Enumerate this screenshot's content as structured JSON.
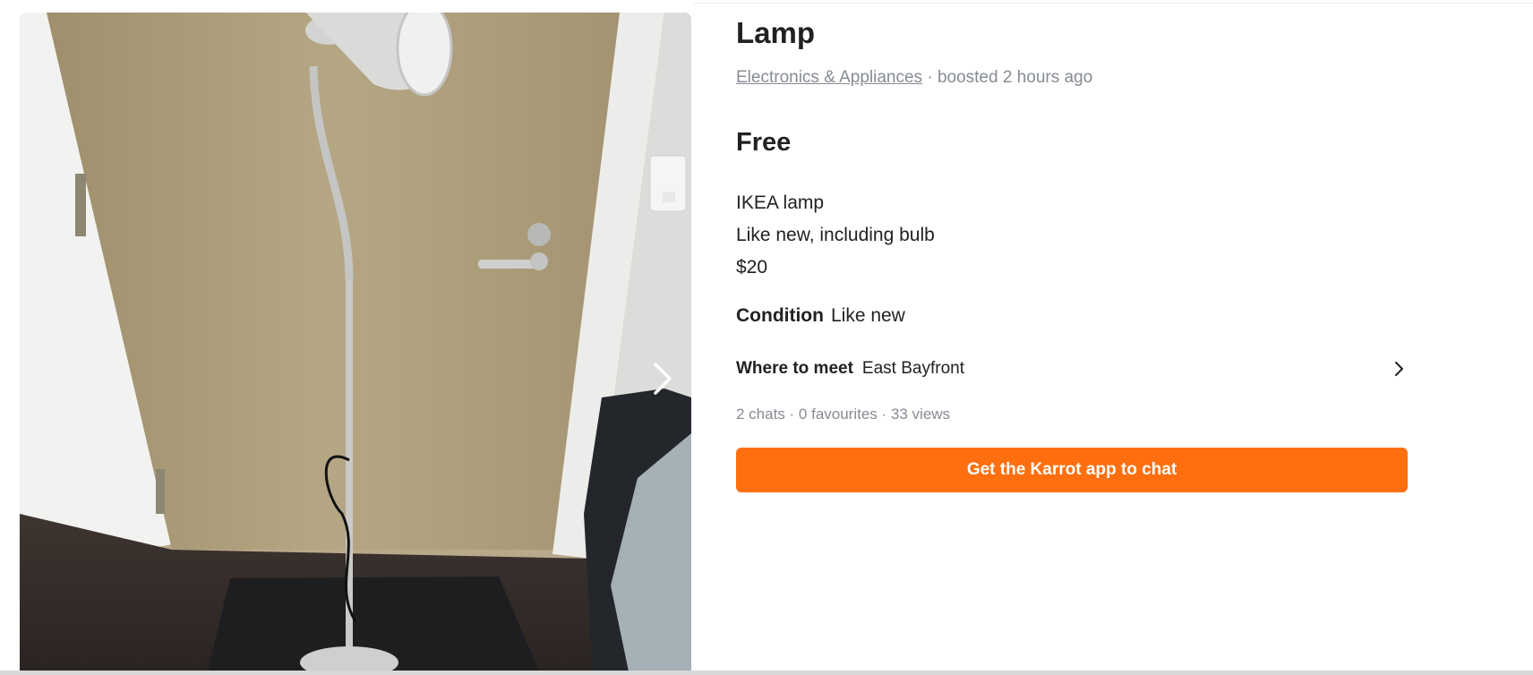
{
  "listing": {
    "title": "Lamp",
    "category": "Electronics & Appliances",
    "boost_text": " · boosted 2 hours ago",
    "price": "Free",
    "description_lines": [
      "IKEA lamp",
      "Like new, including bulb",
      "$20"
    ],
    "condition_label": "Condition",
    "condition_value": "Like new",
    "meet_label": "Where to meet",
    "meet_value": "East Bayfront",
    "stats": "2 chats · 0 favourites · 33 views",
    "cta_label": "Get the Karrot app to chat"
  },
  "icons": {
    "carousel_next": "chevron-right-icon",
    "meet_arrow": "chevron-right-icon"
  },
  "colors": {
    "accent": "#ff6f0f",
    "text_primary": "#212124",
    "text_secondary": "#868b94"
  }
}
